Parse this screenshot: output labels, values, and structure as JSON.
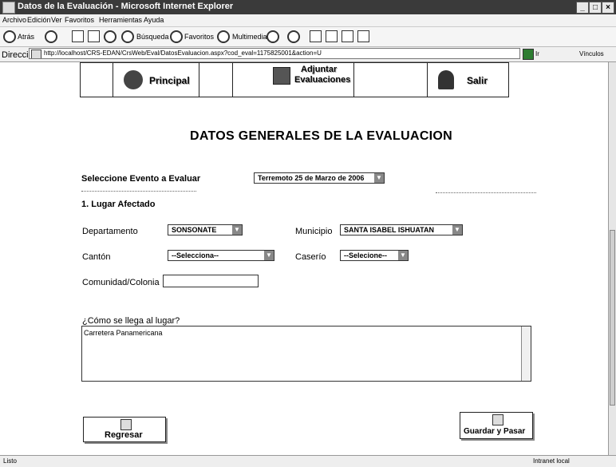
{
  "window": {
    "title": "Datos de la Evaluación - Microsoft Internet Explorer"
  },
  "menu": [
    "Archivo",
    "Edición",
    "Ver",
    "Favoritos",
    "Herramientas",
    "Ayuda"
  ],
  "toolbar": {
    "back": "Atrás",
    "search": "Búsqueda",
    "favorites": "Favoritos",
    "multimedia": "Multimedia"
  },
  "address": {
    "label": "Dirección",
    "url": "http://localhost/CRS-EDAN/CrsWeb/Eval/DatosEvaluacion.aspx?cod_eval=1175825001&action=U",
    "go": "Ir",
    "links": "Vínculos"
  },
  "nav": {
    "principal": "Principal",
    "adjuntar_line1": "Adjuntar",
    "adjuntar_line2": "Evaluaciones",
    "salir": "Salir"
  },
  "page": {
    "title": "DATOS GENERALES DE LA EVALUACION",
    "evento_label": "Seleccione Evento a Evaluar",
    "evento_value": "Terremoto 25 de Marzo de 2006",
    "section1": "1. Lugar Afectado",
    "departamento_label": "Departamento",
    "departamento_value": "SONSONATE",
    "municipio_label": "Municipio",
    "municipio_value": "SANTA ISABEL ISHUATAN",
    "canton_label": "Cantón",
    "canton_value": "--Selecciona--",
    "caserio_label": "Caserío",
    "caserio_value": "--Selecione--",
    "comunidad_label": "Comunidad/Colonia",
    "comunidad_value": "",
    "como_label": "¿Cómo se llega al lugar?",
    "como_value": "Carretera Panamericana"
  },
  "actions": {
    "regresar": "Regresar",
    "guardar": "Guardar y Pasar"
  },
  "status": {
    "left": "Listo",
    "right": "Intranet local"
  }
}
